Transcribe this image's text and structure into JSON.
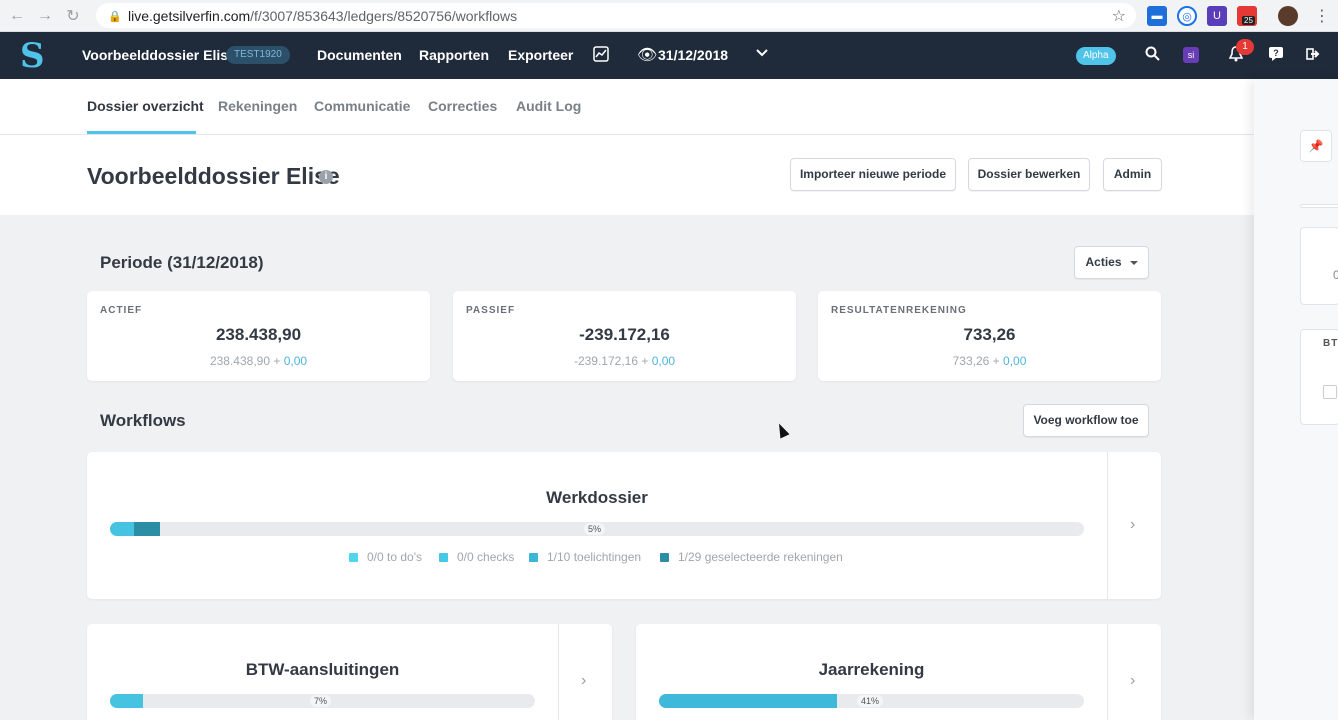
{
  "browser": {
    "url_host": "live.getsilverfin.com",
    "url_path": "/f/3007/853643/ledgers/8520756/workflows",
    "ext_badge_count": "25"
  },
  "topbar": {
    "logo_text": "S",
    "dossier_title": "Voorbeelddossier Elise",
    "dossier_code": "TEST1920",
    "nav": [
      "Documenten",
      "Rapporten",
      "Exporteer"
    ],
    "period": "31/12/2018",
    "alpha_label": "Alpha",
    "app_badge": "si",
    "notification_count": "1"
  },
  "subtabs": [
    "Dossier overzicht",
    "Rekeningen",
    "Communicatie",
    "Correcties",
    "Audit Log"
  ],
  "page": {
    "title": "Voorbeelddossier Elise",
    "info_glyph": "i",
    "buttons": {
      "import": "Importeer nieuwe periode",
      "edit": "Dossier bewerken",
      "admin": "Admin"
    }
  },
  "period_section": {
    "title": "Periode (31/12/2018)",
    "actions_label": "Acties",
    "kpis": [
      {
        "label": "ACTIEF",
        "value": "238.438,90",
        "base": "238.438,90 + ",
        "delta": "0,00"
      },
      {
        "label": "PASSIEF",
        "value": "-239.172,16",
        "base": "-239.172,16 + ",
        "delta": "0,00"
      },
      {
        "label": "RESULTATENREKENING",
        "value": "733,26",
        "base": "733,26 + ",
        "delta": "0,00"
      }
    ]
  },
  "workflows_section": {
    "title": "Workflows",
    "add_label": "Voeg workflow toe",
    "main": {
      "title": "Werkdossier",
      "pct_label": "5%",
      "progress": 0.05,
      "legend": [
        {
          "text": "0/0 to do's",
          "color": "#4fd6ee"
        },
        {
          "text": "0/0 checks",
          "color": "#45c8e4"
        },
        {
          "text": "1/10 toelichtingen",
          "color": "#3ab6d6"
        },
        {
          "text": "1/29 geselecteerde rekeningen",
          "color": "#2b8ea5"
        }
      ]
    },
    "cards": [
      {
        "title": "BTW-aansluitingen",
        "pct_label": "7%",
        "progress": 0.07
      },
      {
        "title": "Jaarrekening",
        "pct_label": "41%",
        "progress": 0.41
      }
    ]
  },
  "drawer": {
    "pin_glyph": "📌",
    "label_bt": "BT",
    "label_0": "0"
  },
  "colors": {
    "accent": "#4fc3e8",
    "topbar_bg": "#1f2a3a",
    "progress_fill": "#3fb9da",
    "progress_dark": "#2b8ea5"
  }
}
